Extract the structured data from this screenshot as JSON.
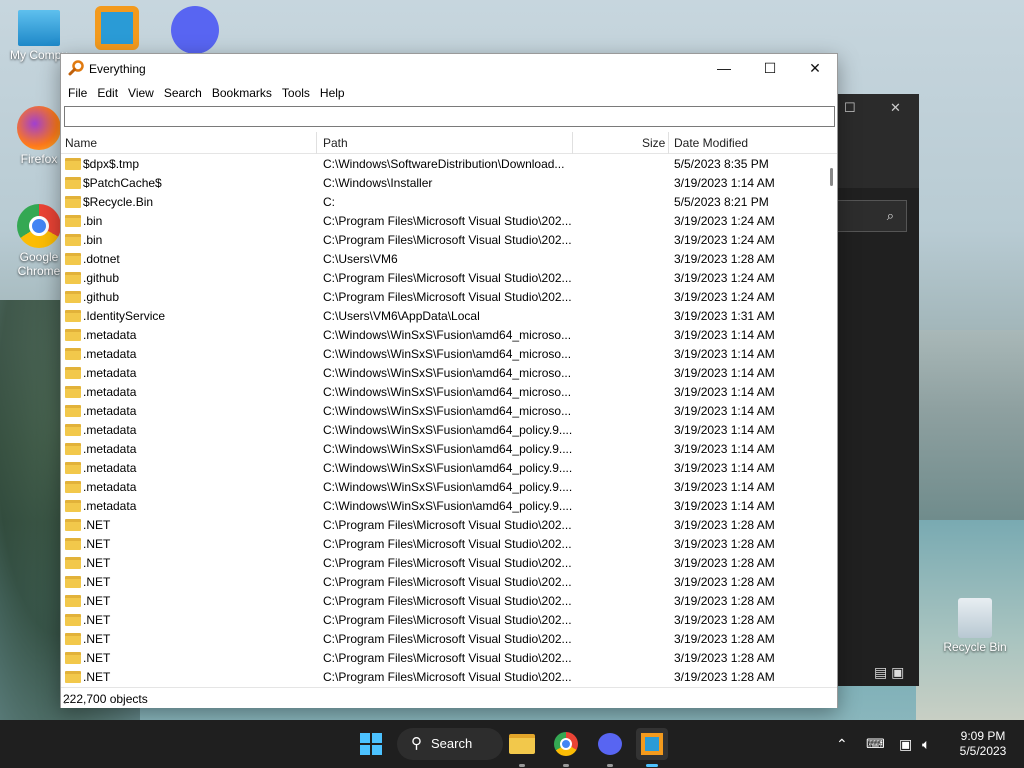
{
  "desktop": {
    "icons": [
      {
        "label": "My Compu"
      },
      {
        "label": "Firefox"
      },
      {
        "label": "Google Chrome"
      },
      {
        "label": "Recycle Bin"
      }
    ]
  },
  "window": {
    "title": "Everything",
    "controls": {
      "minimize": "—",
      "maximize": "☐",
      "close": "✕"
    },
    "menus": [
      "File",
      "Edit",
      "View",
      "Search",
      "Bookmarks",
      "Tools",
      "Help"
    ],
    "search": {
      "value": "",
      "placeholder": ""
    },
    "columns": {
      "name": "Name",
      "path": "Path",
      "size": "Size",
      "date": "Date Modified"
    },
    "rows": [
      {
        "name": "$dpx$.tmp",
        "path": "C:\\Windows\\SoftwareDistribution\\Download...",
        "date": "5/5/2023 8:35 PM"
      },
      {
        "name": "$PatchCache$",
        "path": "C:\\Windows\\Installer",
        "date": "3/19/2023 1:14 AM"
      },
      {
        "name": "$Recycle.Bin",
        "path": "C:",
        "date": "5/5/2023 8:21 PM"
      },
      {
        "name": ".bin",
        "path": "C:\\Program Files\\Microsoft Visual Studio\\202...",
        "date": "3/19/2023 1:24 AM"
      },
      {
        "name": ".bin",
        "path": "C:\\Program Files\\Microsoft Visual Studio\\202...",
        "date": "3/19/2023 1:24 AM"
      },
      {
        "name": ".dotnet",
        "path": "C:\\Users\\VM6",
        "date": "3/19/2023 1:28 AM"
      },
      {
        "name": ".github",
        "path": "C:\\Program Files\\Microsoft Visual Studio\\202...",
        "date": "3/19/2023 1:24 AM"
      },
      {
        "name": ".github",
        "path": "C:\\Program Files\\Microsoft Visual Studio\\202...",
        "date": "3/19/2023 1:24 AM"
      },
      {
        "name": ".IdentityService",
        "path": "C:\\Users\\VM6\\AppData\\Local",
        "date": "3/19/2023 1:31 AM"
      },
      {
        "name": ".metadata",
        "path": "C:\\Windows\\WinSxS\\Fusion\\amd64_microso...",
        "date": "3/19/2023 1:14 AM"
      },
      {
        "name": ".metadata",
        "path": "C:\\Windows\\WinSxS\\Fusion\\amd64_microso...",
        "date": "3/19/2023 1:14 AM"
      },
      {
        "name": ".metadata",
        "path": "C:\\Windows\\WinSxS\\Fusion\\amd64_microso...",
        "date": "3/19/2023 1:14 AM"
      },
      {
        "name": ".metadata",
        "path": "C:\\Windows\\WinSxS\\Fusion\\amd64_microso...",
        "date": "3/19/2023 1:14 AM"
      },
      {
        "name": ".metadata",
        "path": "C:\\Windows\\WinSxS\\Fusion\\amd64_microso...",
        "date": "3/19/2023 1:14 AM"
      },
      {
        "name": ".metadata",
        "path": "C:\\Windows\\WinSxS\\Fusion\\amd64_policy.9....",
        "date": "3/19/2023 1:14 AM"
      },
      {
        "name": ".metadata",
        "path": "C:\\Windows\\WinSxS\\Fusion\\amd64_policy.9....",
        "date": "3/19/2023 1:14 AM"
      },
      {
        "name": ".metadata",
        "path": "C:\\Windows\\WinSxS\\Fusion\\amd64_policy.9....",
        "date": "3/19/2023 1:14 AM"
      },
      {
        "name": ".metadata",
        "path": "C:\\Windows\\WinSxS\\Fusion\\amd64_policy.9....",
        "date": "3/19/2023 1:14 AM"
      },
      {
        "name": ".metadata",
        "path": "C:\\Windows\\WinSxS\\Fusion\\amd64_policy.9....",
        "date": "3/19/2023 1:14 AM"
      },
      {
        "name": ".NET",
        "path": "C:\\Program Files\\Microsoft Visual Studio\\202...",
        "date": "3/19/2023 1:28 AM"
      },
      {
        "name": ".NET",
        "path": "C:\\Program Files\\Microsoft Visual Studio\\202...",
        "date": "3/19/2023 1:28 AM"
      },
      {
        "name": ".NET",
        "path": "C:\\Program Files\\Microsoft Visual Studio\\202...",
        "date": "3/19/2023 1:28 AM"
      },
      {
        "name": ".NET",
        "path": "C:\\Program Files\\Microsoft Visual Studio\\202...",
        "date": "3/19/2023 1:28 AM"
      },
      {
        "name": ".NET",
        "path": "C:\\Program Files\\Microsoft Visual Studio\\202...",
        "date": "3/19/2023 1:28 AM"
      },
      {
        "name": ".NET",
        "path": "C:\\Program Files\\Microsoft Visual Studio\\202...",
        "date": "3/19/2023 1:28 AM"
      },
      {
        "name": ".NET",
        "path": "C:\\Program Files\\Microsoft Visual Studio\\202...",
        "date": "3/19/2023 1:28 AM"
      },
      {
        "name": ".NET",
        "path": "C:\\Program Files\\Microsoft Visual Studio\\202...",
        "date": "3/19/2023 1:28 AM"
      },
      {
        "name": ".NET",
        "path": "C:\\Program Files\\Microsoft Visual Studio\\202...",
        "date": "3/19/2023 1:28 AM"
      }
    ],
    "status": "222,700 objects"
  },
  "taskbar": {
    "search_label": "Search",
    "clock": {
      "time": "9:09 PM",
      "date": "5/5/2023"
    }
  },
  "colors": {
    "folder": "#f2c84b",
    "taskbar": "#1f1f1f",
    "accent": "#0078d4"
  }
}
